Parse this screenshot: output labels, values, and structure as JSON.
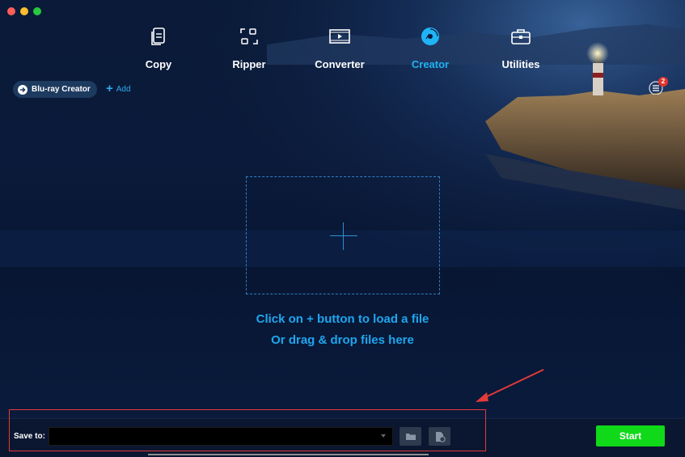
{
  "window": {
    "controls": [
      "close",
      "minimize",
      "maximize"
    ]
  },
  "nav": {
    "items": [
      {
        "label": "Copy",
        "icon": "copy-icon",
        "active": false
      },
      {
        "label": "Ripper",
        "icon": "ripper-icon",
        "active": false
      },
      {
        "label": "Converter",
        "icon": "converter-icon",
        "active": false
      },
      {
        "label": "Creator",
        "icon": "creator-disc-icon",
        "active": true
      },
      {
        "label": "Utilities",
        "icon": "toolbox-icon",
        "active": false
      }
    ]
  },
  "toolbar": {
    "creator_label": "Blu-ray Creator",
    "add_label": "Add",
    "queue_badge": "2"
  },
  "drop_zone": {
    "line1": "Click on + button to load a file",
    "line2": "Or drag & drop files here"
  },
  "bottom": {
    "save_to_label": "Save to:",
    "save_to_value": "",
    "start_label": "Start"
  },
  "colors": {
    "accent": "#1ea6ef",
    "start": "#10d91a",
    "annotation": "#e43a3a"
  }
}
